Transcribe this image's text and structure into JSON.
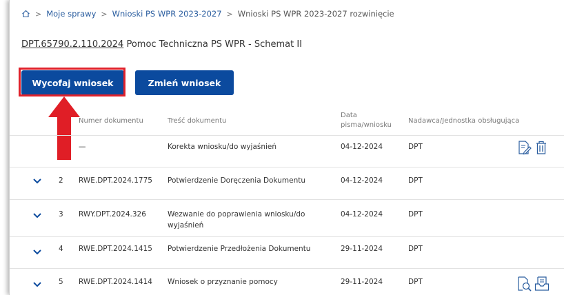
{
  "breadcrumb": {
    "items": [
      "Moje sprawy",
      "Wnioski PS WPR 2023-2027",
      "Wnioski PS WPR 2023-2027 rozwinięcie"
    ]
  },
  "case": {
    "number": "DPT.65790.2.110.2024",
    "title": "Pomoc Techniczna PS WPR - Schemat II"
  },
  "actions": {
    "withdraw_label": "Wycofaj wniosek",
    "change_label": "Zmień wniosek"
  },
  "table": {
    "headers": {
      "doc_number": "Numer dokumentu",
      "content": "Treść dokumentu",
      "date_line1": "Data",
      "date_line2": "pisma/wniosku",
      "sender": "Nadawca/Jednostka obsługująca"
    },
    "rows": [
      {
        "num": "",
        "doc": "—",
        "content": "Korekta wniosku/do wyjaśnień",
        "date": "04-12-2024",
        "sender": "DPT"
      },
      {
        "num": "2",
        "doc": "RWE.DPT.2024.1775",
        "content": "Potwierdzenie Doręczenia Dokumentu",
        "date": "04-12-2024",
        "sender": "DPT"
      },
      {
        "num": "3",
        "doc": "RWY.DPT.2024.326",
        "content": "Wezwanie do poprawienia wniosku/do",
        "content2": "wyjaśnień",
        "date": "04-12-2024",
        "sender": "DPT"
      },
      {
        "num": "4",
        "doc": "RWE.DPT.2024.1415",
        "content": "Potwierdzenie Przedłożenia Dokumentu",
        "date": "29-11-2024",
        "sender": "DPT"
      },
      {
        "num": "5",
        "doc": "RWE.DPT.2024.1414",
        "content": "Wniosek o przyznanie pomocy",
        "date": "29-11-2024",
        "sender": "DPT"
      }
    ]
  },
  "colors": {
    "primary": "#0b4a9e",
    "highlight": "#e0202a",
    "link": "#2a5d9f"
  },
  "icons": [
    "home-icon",
    "edit-document-icon",
    "trash-icon",
    "search-document-icon",
    "inbox-document-icon",
    "chevron-down-icon",
    "red-arrow-annotation"
  ]
}
